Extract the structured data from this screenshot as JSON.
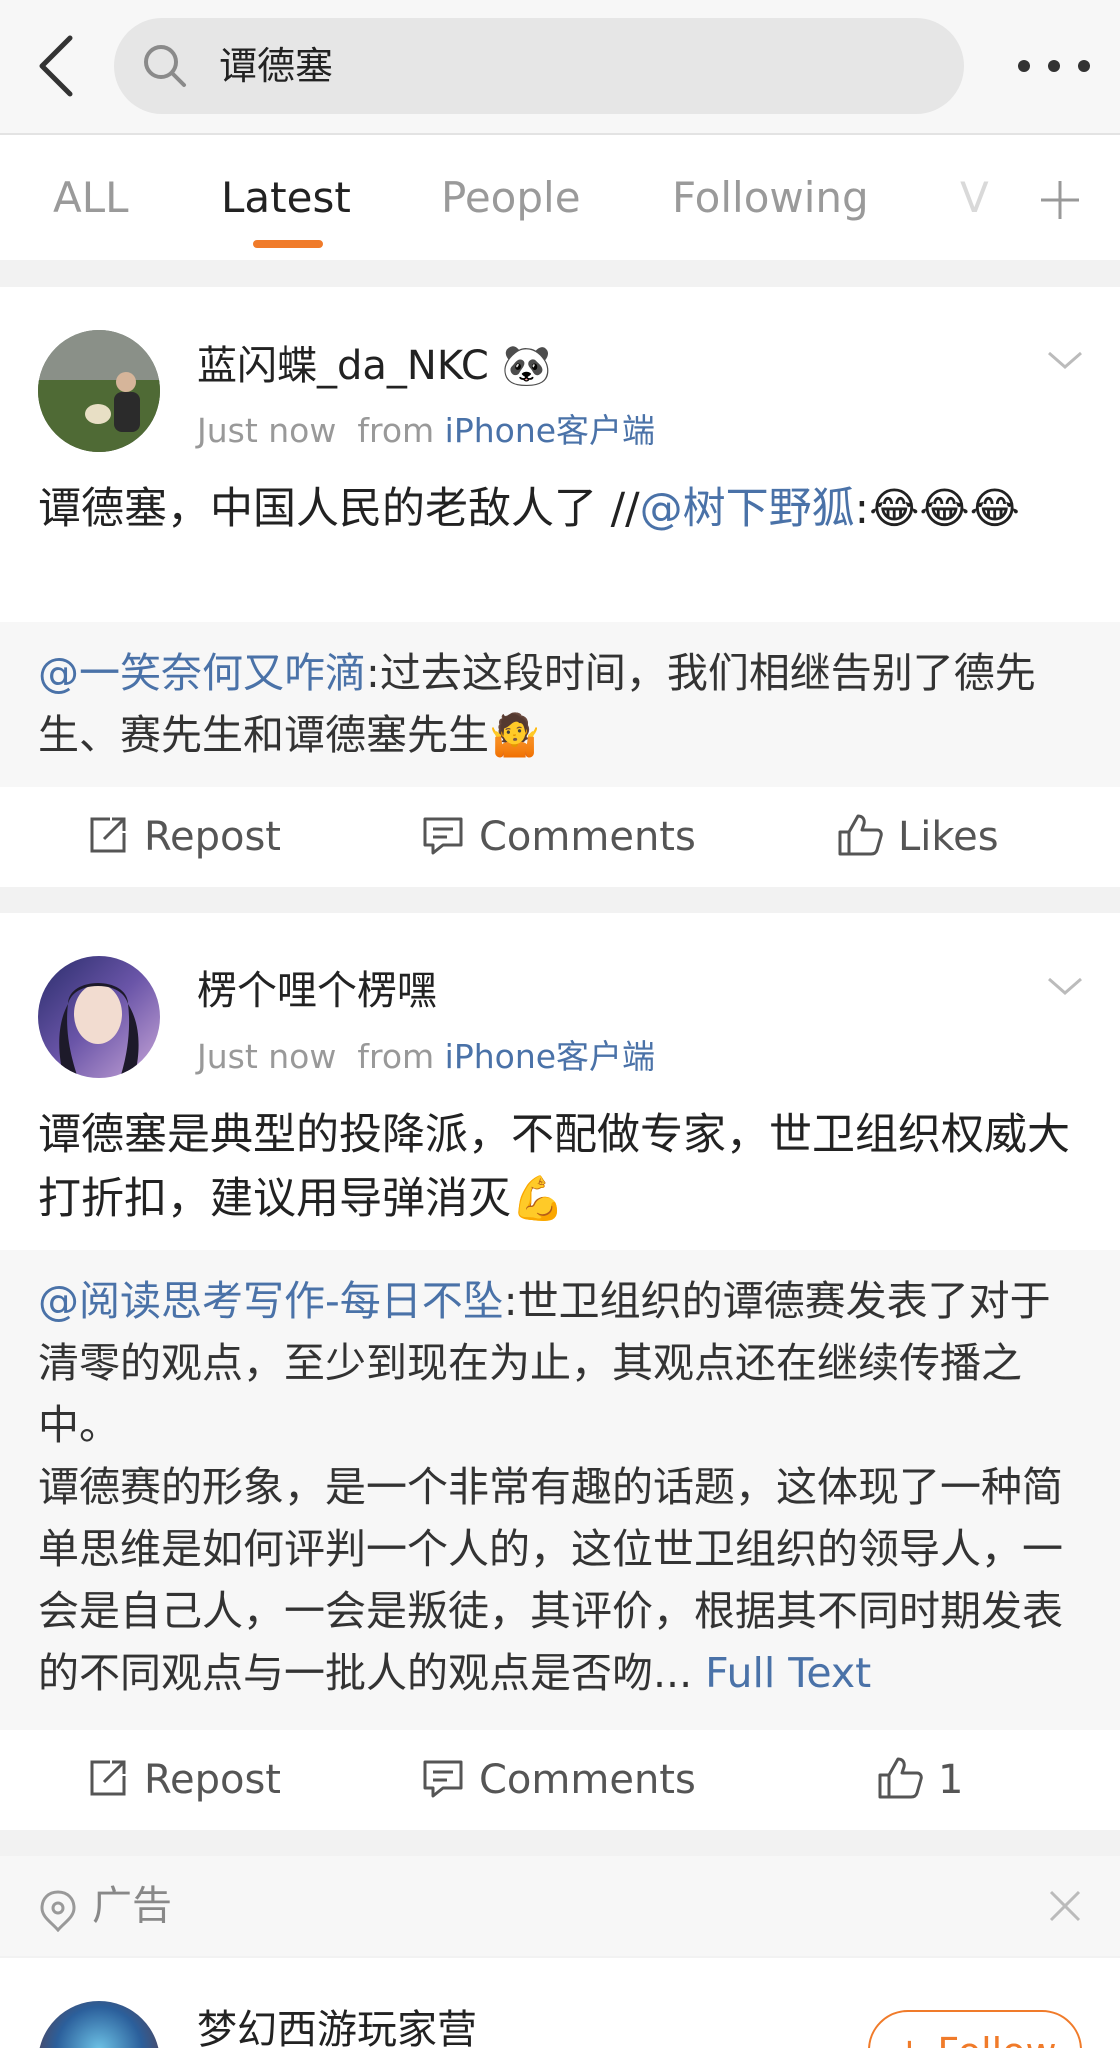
{
  "search": {
    "query": "谭德塞"
  },
  "tabs": [
    {
      "label": "ALL"
    },
    {
      "label": "Latest"
    },
    {
      "label": "People"
    },
    {
      "label": "Following"
    },
    {
      "label": "V"
    }
  ],
  "posts": [
    {
      "username": "蓝闪蝶_da_NKC",
      "time": "Just now",
      "from_label": "from",
      "source": "iPhone客户端",
      "body_text": "谭德塞，中国人民的老敌人了 //",
      "body_mention": "@树下野狐",
      "body_tail": ":😂😂😂",
      "repost_mention": "@一笑奈何又咋滴",
      "repost_text": ":过去这段时间，我们相继告别了德先生、赛先生和谭德塞先生🤷",
      "repost_label": "Repost",
      "comments_label": "Comments",
      "likes_label": "Likes"
    },
    {
      "username": "楞个哩个楞嘿",
      "time": "Just now",
      "from_label": "from",
      "source": "iPhone客户端",
      "body_text": "谭德塞是典型的投降派，不配做专家，世卫组织权威大打折扣，建议用导弹消灭💪",
      "repost_mention": "@阅读思考写作-每日不坠",
      "repost_text_1": ":世卫组织的谭德赛发表了对于清零的观点，至少到现在为止，其观点还在继续传播之中。",
      "repost_text_2": "谭德赛的形象，是一个非常有趣的话题，这体现了一种简单思维是如何评判一个人的，这位世卫组织的领导人，一会是自己人，一会是叛徒，其评价，根据其不同时期发表的不同观点与一批人的观点是否吻...",
      "full_text_label": "Full Text",
      "repost_label": "Repost",
      "comments_label": "Comments",
      "likes_count": "1"
    }
  ],
  "ad": {
    "label": "广告",
    "username": "梦幻西游玩家营",
    "follow_label": "+ Follow"
  }
}
